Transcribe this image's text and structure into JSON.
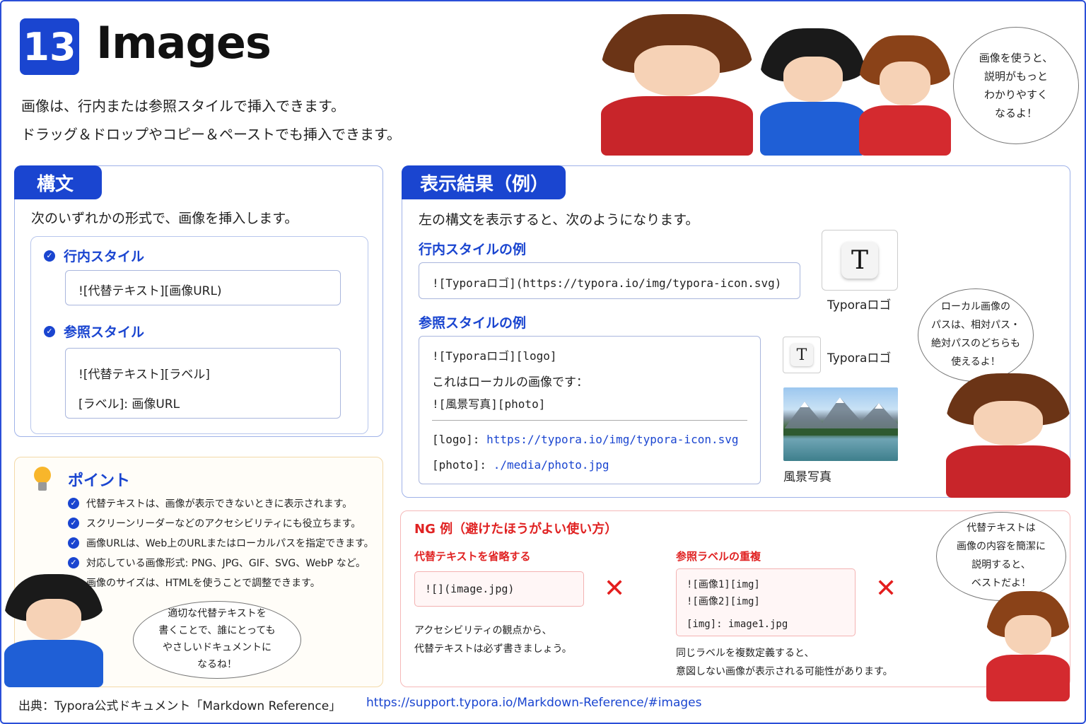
{
  "header": {
    "number": "13",
    "title": "Images",
    "intro_lines": [
      "画像は、行内または参照スタイルで挿入できます。",
      "ドラッグ＆ドロップやコピー＆ペーストでも挿入できます。"
    ],
    "bubble": [
      "画像を使うと、",
      "説明がもっと",
      "わかりやすく",
      "なるよ！"
    ]
  },
  "syntax": {
    "tab": "構文",
    "lead": "次のいずれかの形式で、画像を挿入します。",
    "inline_title": "行内スタイル",
    "inline_code": "![代替テキスト][画像URL)",
    "ref_title": "参照スタイル",
    "ref_code": [
      "![代替テキスト][ラベル]",
      "[ラベル]: 画像URL"
    ]
  },
  "result": {
    "tab": "表示結果（例）",
    "lead": "左の構文を表示すると、次のようになります。",
    "inline_title": "行内スタイルの例",
    "inline_code": "![Typoraロゴ](https://typora.io/img/typora-icon.svg)",
    "logo_caption": "Typoraロゴ",
    "logo_letter": "T",
    "ref_title": "参照スタイルの例",
    "ref_lines": [
      "![Typoraロゴ][logo]",
      "これはローカルの画像です：",
      "![風景写真][photo]"
    ],
    "ref_def1_label": "[logo]:",
    "ref_def1_url": "https://typora.io/img/typora-icon.svg",
    "ref_def2_label": "[photo]:",
    "ref_def2_url": "./media/photo.jpg",
    "small_logo_caption": "Typoraロゴ",
    "photo_caption": "風景写真",
    "bubble": [
      "ローカル画像の",
      "パスは、相対パス・",
      "絶対パスのどちらも",
      "使えるよ！"
    ]
  },
  "point": {
    "title": "ポイント",
    "items": [
      "代替テキストは、画像が表示できないときに表示されます。",
      "スクリーンリーダーなどのアクセシビリティにも役立ちます。",
      "画像URLは、Web上のURLまたはローカルパスを指定できます。",
      "対応している画像形式: PNG、JPG、GIF、SVG、WebP など。",
      "画像のサイズは、HTMLを使うことで調整できます。"
    ],
    "bubble": [
      "適切な代替テキストを",
      "書くことで、誰にとっても",
      "やさしいドキュメントに",
      "なるね！"
    ]
  },
  "ng": {
    "title": "NG 例（避けたほうがよい使い方）",
    "left_title": "代替テキストを省略する",
    "left_code": "![](image.jpg)",
    "left_note": [
      "アクセシビリティの観点から、",
      "代替テキストは必ず書きましょう。"
    ],
    "right_title": "参照ラベルの重複",
    "right_code": [
      "![画像1][img]",
      "![画像2][img]",
      "[img]: image1.jpg"
    ],
    "right_note": [
      "同じラベルを複数定義すると、",
      "意図しない画像が表示される可能性があります。"
    ],
    "x": "✕",
    "bubble": [
      "代替テキストは",
      "画像の内容を簡潔に",
      "説明すると、",
      "ベストだよ！"
    ]
  },
  "footer": {
    "source": "出典：Typora公式ドキュメント「Markdown Reference」",
    "url": "https://support.typora.io/Markdown-Reference/#images"
  },
  "colors": {
    "accent": "#1a45d0",
    "ng_red": "#e02222",
    "point_border": "#f3d9a8"
  }
}
